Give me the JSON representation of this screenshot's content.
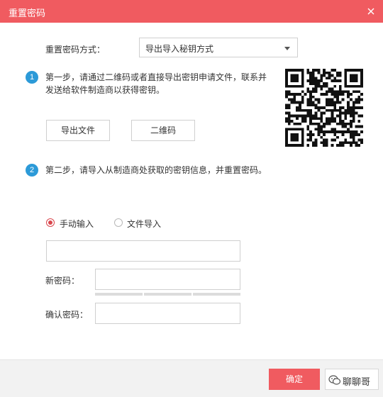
{
  "dialog": {
    "title": "重置密码"
  },
  "reset_method": {
    "label": "重置密码方式：",
    "selected": "导出导入秘钥方式"
  },
  "step1": {
    "number": "1",
    "text": "第一步，请通过二维码或者直接导出密钥申请文件，联系并发送给软件制造商以获得密钥。",
    "export_button": "导出文件",
    "qrcode_button": "二维码"
  },
  "step2": {
    "number": "2",
    "text": "第二步，请导入从制造商处获取的密钥信息，并重置密码。",
    "radio_manual": "手动输入",
    "radio_file": "文件导入",
    "manual_selected": true,
    "key_value": "",
    "new_password_label": "新密码：",
    "confirm_password_label": "确认密码："
  },
  "footer": {
    "ok_label": "确定",
    "watermark": "聊聊哥"
  },
  "colors": {
    "accent": "#f05b60",
    "step_badge": "#2c9ad8"
  }
}
